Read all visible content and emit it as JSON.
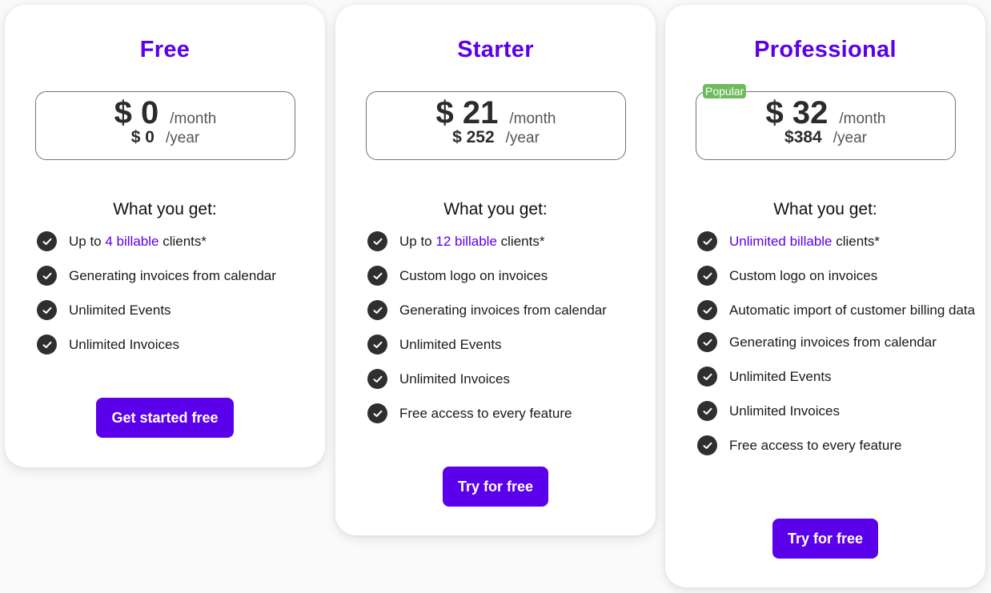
{
  "brand_color": "#5b00ea",
  "badge_color": "#6fba5c",
  "plans": [
    {
      "name": "Free",
      "monthly_price": "$ 0",
      "monthly_period": "/month",
      "yearly_price": "$ 0",
      "yearly_period": "/year",
      "features_heading": "What you get:",
      "features": [
        {
          "pre": "Up to ",
          "highlight": "4 billable",
          "post": " clients*"
        },
        {
          "pre": "Generating invoices from calendar",
          "highlight": "",
          "post": ""
        },
        {
          "pre": "Unlimited Events",
          "highlight": "",
          "post": ""
        },
        {
          "pre": "Unlimited Invoices",
          "highlight": "",
          "post": ""
        }
      ],
      "cta_label": "Get started free",
      "check_icon": "check-circle-icon"
    },
    {
      "name": "Starter",
      "monthly_price": "$ 21",
      "monthly_period": "/month",
      "yearly_price": "$ 252",
      "yearly_period": "/year",
      "features_heading": "What you get:",
      "features": [
        {
          "pre": "Up to ",
          "highlight": "12 billable",
          "post": " clients*"
        },
        {
          "pre": "Custom logo on invoices",
          "highlight": "",
          "post": ""
        },
        {
          "pre": "Generating invoices from calendar",
          "highlight": "",
          "post": ""
        },
        {
          "pre": "Unlimited Events",
          "highlight": "",
          "post": ""
        },
        {
          "pre": "Unlimited Invoices",
          "highlight": "",
          "post": ""
        },
        {
          "pre": "Free access to every feature",
          "highlight": "",
          "post": ""
        }
      ],
      "cta_label": "Try for free",
      "check_icon": "check-circle-icon"
    },
    {
      "name": "Professional",
      "badge": "Popular",
      "monthly_price": "$ 32",
      "monthly_period": "/month",
      "yearly_price": "$384",
      "yearly_period": "/year",
      "features_heading": "What you get:",
      "features": [
        {
          "pre": "",
          "highlight": "Unlimited billable",
          "post": " clients*"
        },
        {
          "pre": "Custom logo on invoices",
          "highlight": "",
          "post": ""
        },
        {
          "pre": "Automatic import of customer billing data",
          "highlight": "",
          "post": ""
        },
        {
          "pre": "Generating invoices from calendar",
          "highlight": "",
          "post": ""
        },
        {
          "pre": "Unlimited Events",
          "highlight": "",
          "post": ""
        },
        {
          "pre": "Unlimited Invoices",
          "highlight": "",
          "post": ""
        },
        {
          "pre": "Free access to every feature",
          "highlight": "",
          "post": ""
        }
      ],
      "cta_label": "Try for free",
      "check_icon": "check-circle-icon"
    }
  ]
}
